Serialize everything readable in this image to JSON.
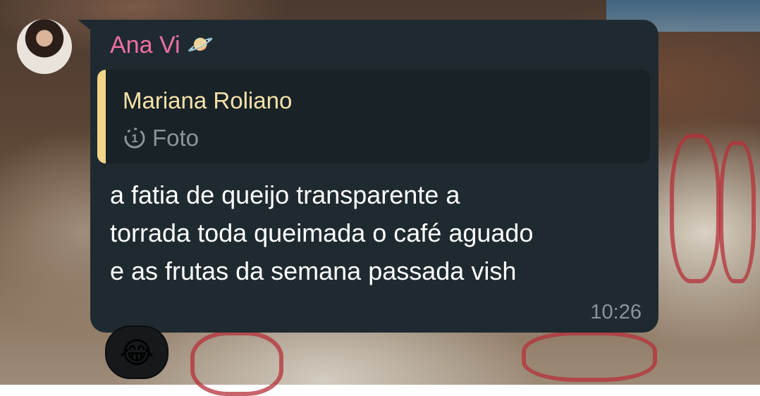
{
  "sender": {
    "name": "Ana Vi",
    "badge_emoji": "🪐"
  },
  "reply": {
    "author": "Mariana Roliano",
    "media_label": "Foto",
    "media_icon": "view-once-1-icon",
    "accent_color": "#f2d68a"
  },
  "message": {
    "lines": [
      "a fatia de queijo transparente a",
      "torrada toda queimada o café aguado",
      "e as frutas da semana passada vish"
    ],
    "time": "10:26"
  },
  "reaction": {
    "emoji": "😂"
  },
  "colors": {
    "bubble": "#1f2a30",
    "sender_name": "#ef6fa3",
    "reply_author": "#f7e2a9",
    "meta_text": "#8a959b"
  }
}
